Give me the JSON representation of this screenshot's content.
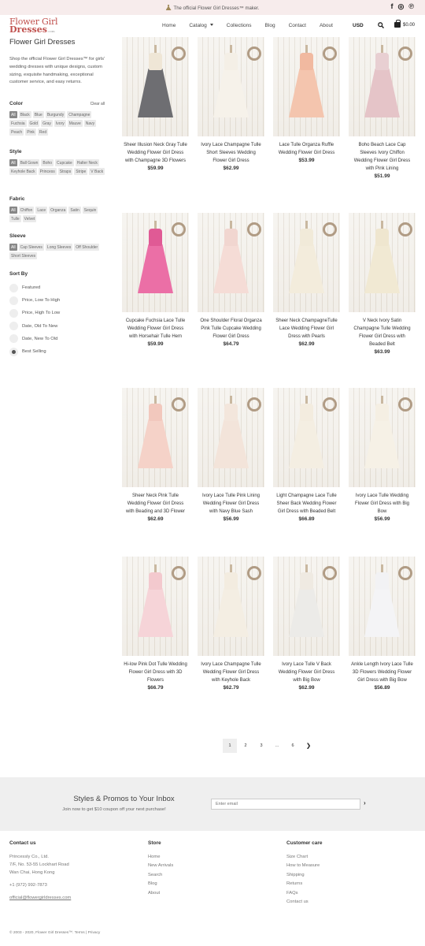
{
  "announcement": "The official Flower Girl Dresses™ maker.",
  "social": [
    "facebook-icon",
    "instagram-icon",
    "pinterest-icon"
  ],
  "logo": {
    "line1": "Flower Girl",
    "line2": "Dresses",
    "suffix": ".com"
  },
  "nav": [
    {
      "label": "Home"
    },
    {
      "label": "Catalog"
    },
    {
      "label": "Collections"
    },
    {
      "label": "Blog"
    },
    {
      "label": "Contact"
    },
    {
      "label": "About"
    }
  ],
  "currency": "USD",
  "cart_total": "$0.00",
  "sidebar": {
    "title": "Flower Girl Dresses",
    "intro": "Shop the official Flower Girl Dresses™ for girls' wedding dresses with unique designs, custom sizing, exquisite handmaking, exceptional customer service, and easy returns.",
    "clear_label": "Clear all",
    "filters": [
      {
        "title": "Color",
        "options": [
          "All",
          "Black",
          "Blue",
          "Burgundy",
          "Champagne",
          "Fuchsia",
          "Gold",
          "Gray",
          "Ivory",
          "Mauve",
          "Navy",
          "Peach",
          "Pink",
          "Red"
        ]
      },
      {
        "title": "Style",
        "options": [
          "All",
          "Ball Gown",
          "Boho",
          "Cupcake",
          "Halter Neck",
          "Keyhole Back",
          "Princess",
          "Straps",
          "Stripe",
          "V Back"
        ]
      },
      {
        "title": "Fabric",
        "options": [
          "All",
          "Chiffon",
          "Lace",
          "Organza",
          "Satin",
          "Sequin",
          "Tulle",
          "Velvet"
        ]
      },
      {
        "title": "Sleeve",
        "options": [
          "All",
          "Cap Sleeves",
          "Long Sleeves",
          "Off Shoulder",
          "Short Sleeves"
        ]
      }
    ],
    "sort": {
      "title": "Sort By",
      "options": [
        "Featured",
        "Price, Low To High",
        "Price, High To Low",
        "Date, Old To New",
        "Date, New To Old",
        "Best Selling"
      ],
      "selected": "Best Selling"
    }
  },
  "products": [
    {
      "name": "Sheer Illusion Neck Gray Tulle Wedding Flower Girl Dress with Champagne 3D Flowers",
      "price": "$59.99",
      "bodice": "#efe6d6",
      "skirt": "#6e6e72"
    },
    {
      "name": "Ivory Lace Champagne Tulle Short Sleeves Wedding Flower Girl Dress",
      "price": "$62.99",
      "bodice": "#f4efe6",
      "skirt": "#f6f2ea"
    },
    {
      "name": "Lace Tulle Organza Ruffle Wedding Flower Girl Dress",
      "price": "$53.99",
      "bodice": "#f1b9a0",
      "skirt": "#f4c5ae"
    },
    {
      "name": "Boho Beach Lace Cap Sleeves Ivory Chiffon Wedding Flower Girl Dress with Pink Lining",
      "price": "$51.99",
      "bodice": "#e8cfd2",
      "skirt": "#e5c4c8"
    },
    {
      "name": "Cupcake Fuchsia Lace Tulle Wedding Flower Girl Dress with Horsehair Tulle Hem",
      "price": "$59.99",
      "bodice": "#e05a95",
      "skirt": "#eb6fa6"
    },
    {
      "name": "One Shoulder Floral Organza Pink Tulle Cupcake Wedding Flower Girl Dress",
      "price": "$64.79",
      "bodice": "#f1d6d0",
      "skirt": "#f5dcd6"
    },
    {
      "name": "Sheer Neck ChampagneTulle Lace Wedding Flower Girl Dress with Pearls",
      "price": "$62.99",
      "bodice": "#f1ead9",
      "skirt": "#f3ecdc"
    },
    {
      "name": "V Neck Ivory Satin Champagne Tulle Wedding Flower Girl Dress with Beaded Belt",
      "price": "$63.99",
      "bodice": "#efe6cf",
      "skirt": "#f1e9d3"
    },
    {
      "name": "Sheer Neck Pink Tulle Wedding Flower Girl Dress with Beading and 3D Flower",
      "price": "$62.69",
      "bodice": "#f2c8bd",
      "skirt": "#f5d2c8"
    },
    {
      "name": "Ivory Lace Tulle Pink Lining Wedding Flower Girl Dress with Navy Blue Sash",
      "price": "$56.99",
      "bodice": "#f3e6dc",
      "skirt": "#f3e4da"
    },
    {
      "name": "Light Champagne Lace Tulle Sheer Back Wedding Flower Girl Dress with Beaded Belt",
      "price": "$66.89",
      "bodice": "#f3ecdf",
      "skirt": "#f4eee2"
    },
    {
      "name": "Ivory Lace Tulle Wedding Flower Girl Dress with Big Bow",
      "price": "$56.99",
      "bodice": "#f5efe3",
      "skirt": "#f6f1e6"
    },
    {
      "name": "Hi-low Pink Dot Tulle Wedding Flower Girl Dress with 3D Flowers",
      "price": "$66.79",
      "bodice": "#f3c9ce",
      "skirt": "#f6d4d8"
    },
    {
      "name": "Ivory Lace Champagne Tulle Wedding Flower Girl Dress with Keyhole Back",
      "price": "$62.79",
      "bodice": "#f3ece0",
      "skirt": "#f4eee3"
    },
    {
      "name": "Ivory Lace Tulle V Back Wedding Flower Girl Dress with Big Bow",
      "price": "$62.99",
      "bodice": "#efeae2",
      "skirt": "#ecebe8"
    },
    {
      "name": "Ankle Length Ivory Lace Tulle 3D Flowers Wedding Flower Girl Dress with Big Bow",
      "price": "$56.89",
      "bodice": "#f2f2f4",
      "skirt": "#f4f4f6"
    }
  ],
  "pagination": {
    "pages": [
      "1",
      "2",
      "3",
      "…",
      "6"
    ],
    "current": "1",
    "next": "❯"
  },
  "newsletter": {
    "title": "Styles & Promos to Your Inbox",
    "subtitle": "Join now to get $10 coupon off your next purchase!",
    "placeholder": "Enter email"
  },
  "footer": {
    "contact": {
      "title": "Contact us",
      "address": [
        "Princessly Co., Ltd.",
        "7/F, No. 53-55 Lockhart Road",
        "Wan Chai, Hong Kong"
      ],
      "phone": "+1 (972) 992-7873",
      "email": "official@flowergirldresses.com"
    },
    "store": {
      "title": "Store",
      "links": [
        "Home",
        "New Arrivals",
        "Search",
        "Blog",
        "About"
      ]
    },
    "care": {
      "title": "Customer care",
      "links": [
        "Size Chart",
        "How to Measure",
        "Shipping",
        "Returns",
        "FAQs",
        "Contact us"
      ]
    },
    "copyright": "© 2003 - 2020, Flower Girl Dresses™. Terms | Privacy"
  }
}
